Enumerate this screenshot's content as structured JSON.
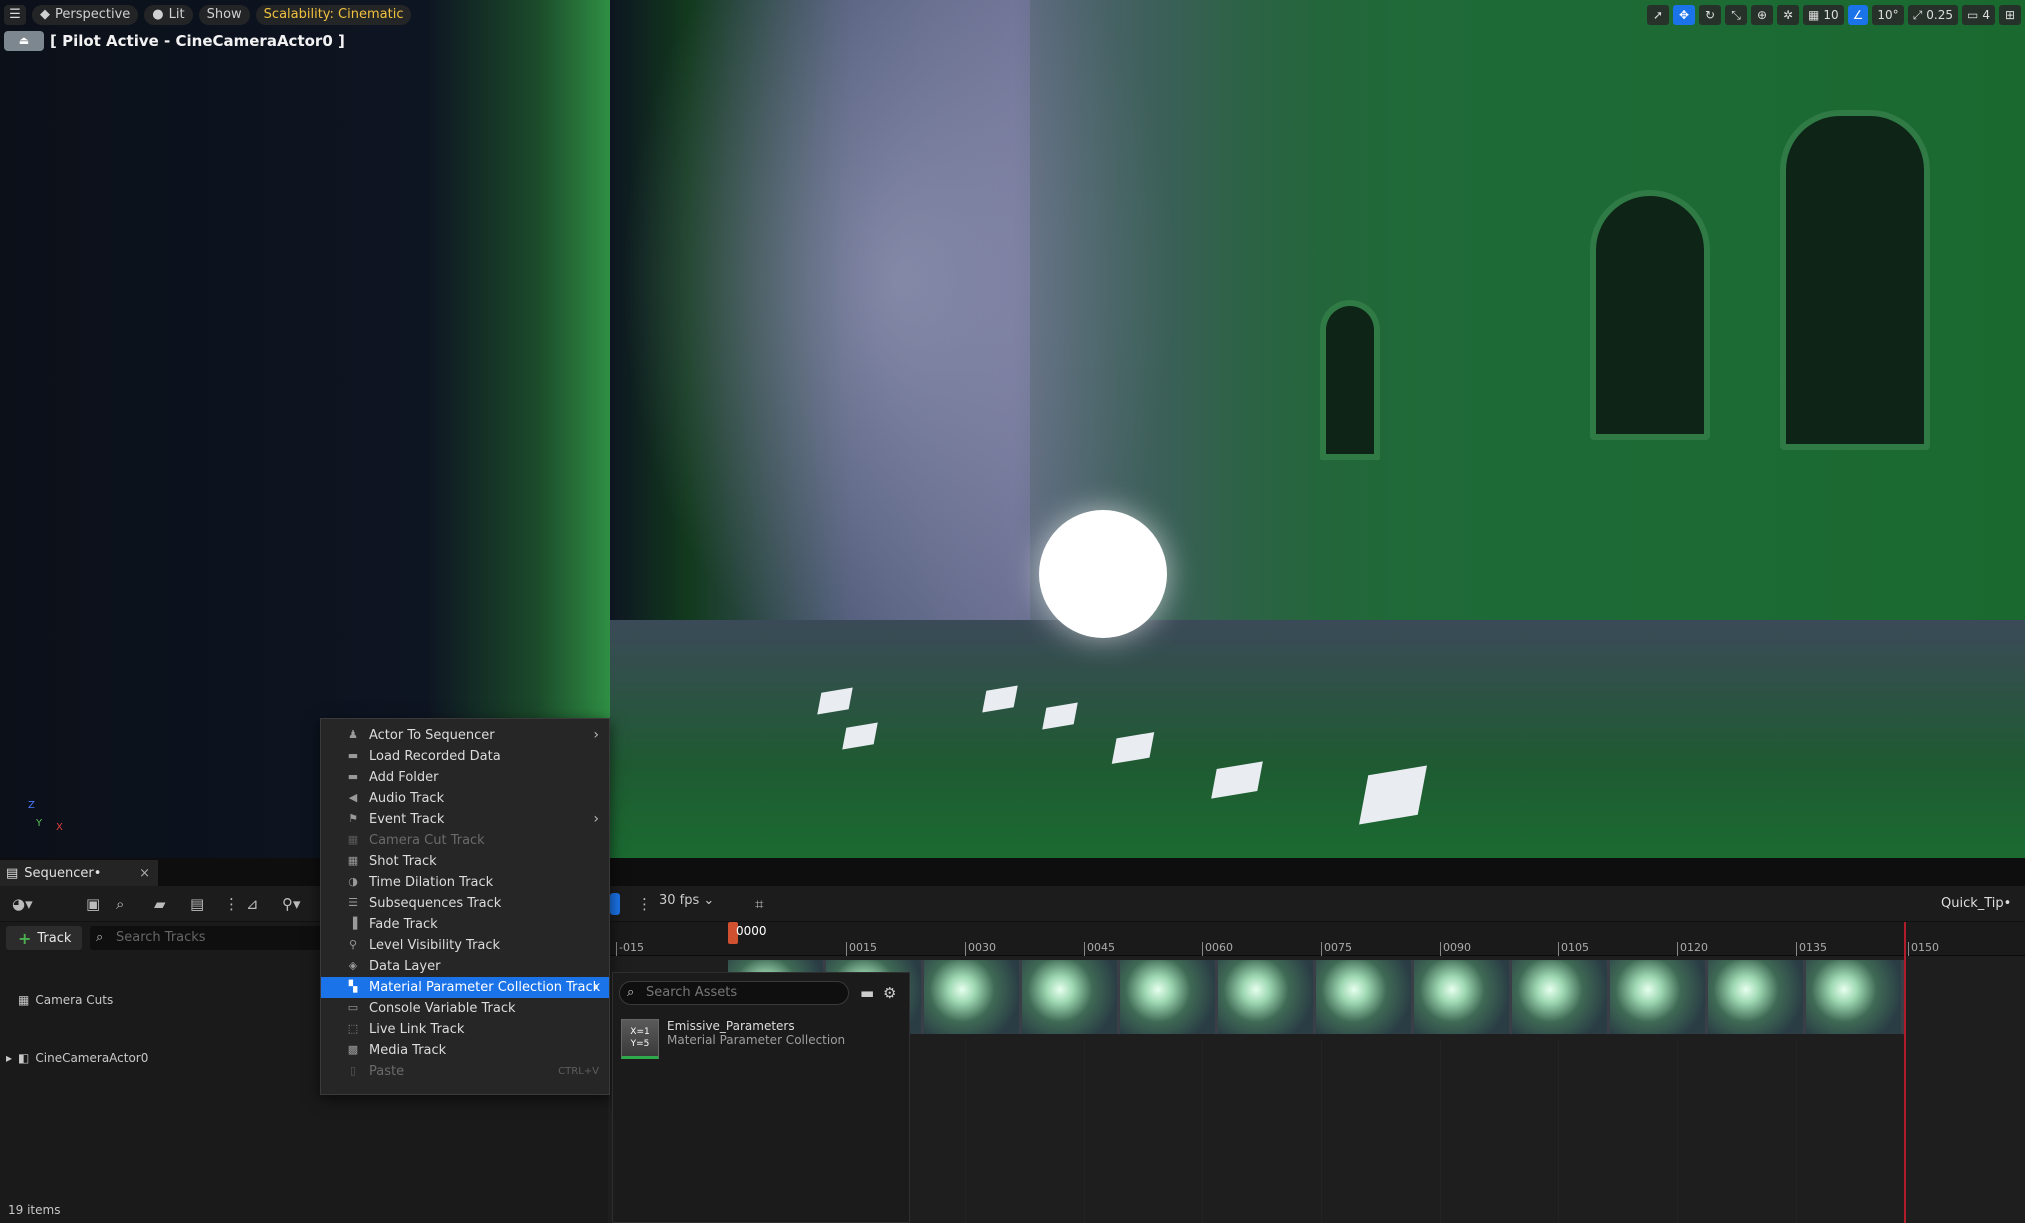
{
  "viewport": {
    "menu_icon": "hamburger-icon",
    "perspective_label": "Perspective",
    "lit_label": "Lit",
    "show_label": "Show",
    "scalability_label": "Scalability: Cinematic",
    "pilot_text": "[ Pilot Active - CineCameraActor0 ]",
    "right_toolbar": {
      "grid_snap_value": "10",
      "rotation_snap_value": "10°",
      "scale_snap_value": "0.25",
      "camera_speed_value": "4"
    },
    "axis_y": "Y",
    "axis_x": "X",
    "axis_z": "Z"
  },
  "sequencer": {
    "tab_label": "Sequencer•",
    "tab_close": "×",
    "fps_label": "30 fps",
    "quick_tip": "Quick_Tip•",
    "track_button_label": "Track",
    "search_tracks_placeholder": "Search Tracks",
    "tracks": [
      {
        "label": "Camera Cuts"
      },
      {
        "label": "CineCameraActor0"
      }
    ],
    "items_count": "19 items",
    "current_frame": "0000",
    "ruler_ticks": [
      "-015",
      "0015",
      "0030",
      "0045",
      "0060",
      "0075",
      "0090",
      "0105",
      "0120",
      "0135",
      "0150"
    ]
  },
  "context_menu": {
    "items": [
      {
        "label": "Actor To Sequencer",
        "icon": "actor-icon",
        "submenu": true
      },
      {
        "label": "Load Recorded Data",
        "icon": "folder-open-icon"
      },
      {
        "label": "Add Folder",
        "icon": "folder-icon"
      },
      {
        "label": "Audio Track",
        "icon": "speaker-icon"
      },
      {
        "label": "Event Track",
        "icon": "flag-icon",
        "submenu": true
      },
      {
        "label": "Camera Cut Track",
        "icon": "camera-cut-icon",
        "disabled": true
      },
      {
        "label": "Shot Track",
        "icon": "film-icon"
      },
      {
        "label": "Time Dilation Track",
        "icon": "time-dilation-icon"
      },
      {
        "label": "Subsequences Track",
        "icon": "subsequence-icon"
      },
      {
        "label": "Fade Track",
        "icon": "fade-icon"
      },
      {
        "label": "Level Visibility Track",
        "icon": "level-visibility-icon"
      },
      {
        "label": "Data Layer",
        "icon": "data-layer-icon"
      },
      {
        "label": "Material Parameter Collection Track",
        "icon": "material-param-icon",
        "submenu": true,
        "selected": true
      },
      {
        "label": "Console Variable Track",
        "icon": "console-icon"
      },
      {
        "label": "Live Link Track",
        "icon": "live-link-icon"
      },
      {
        "label": "Media Track",
        "icon": "media-icon"
      },
      {
        "label": "Paste",
        "icon": "paste-icon",
        "disabled": true,
        "shortcut": "CTRL+V"
      }
    ]
  },
  "submenu": {
    "search_placeholder": "Search Assets",
    "asset_name": "Emissive_Parameters",
    "asset_type": "Material Parameter Collection",
    "asset_thumb_text": "X=1 Y=5"
  },
  "colors": {
    "accent": "#1a73e8",
    "scalability": "#f0c040",
    "end_marker": "#b01c28",
    "playhead": "#d05030"
  }
}
